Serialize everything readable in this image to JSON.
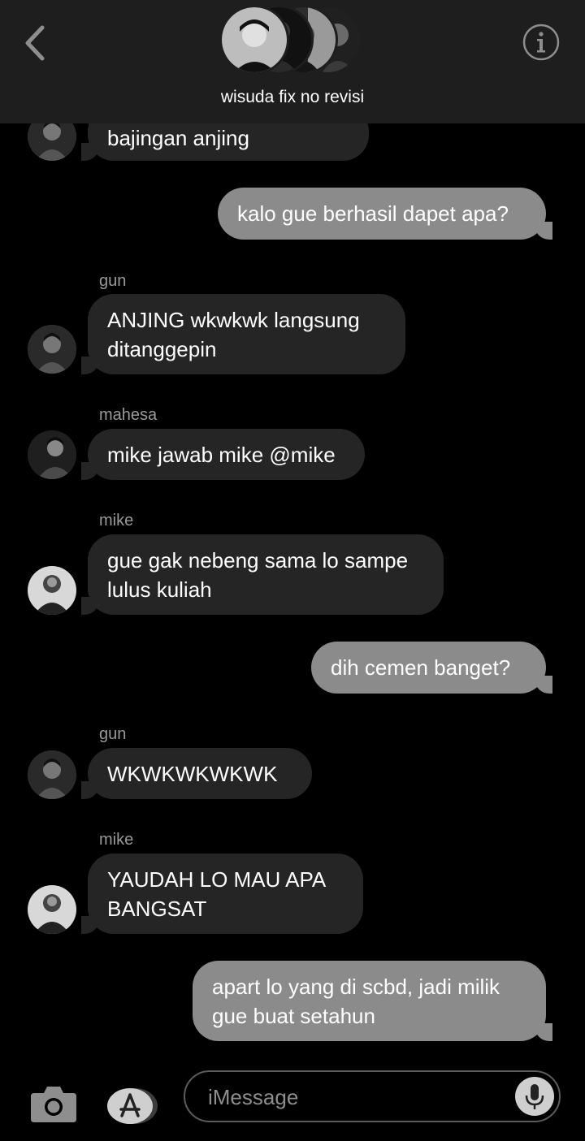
{
  "header": {
    "title": "wisuda fix no revisi",
    "back_icon": "chevron-left-icon",
    "info_icon": "info-icon"
  },
  "messages": [
    {
      "sender": "",
      "text": "bajingan anjing",
      "direction": "incoming"
    },
    {
      "sender": "",
      "text": "kalo gue berhasil dapet apa?",
      "direction": "outgoing"
    },
    {
      "sender": "gun",
      "text": "ANJING wkwkwk langsung ditanggepin",
      "direction": "incoming"
    },
    {
      "sender": "mahesa",
      "text": "mike jawab mike @mike",
      "direction": "incoming"
    },
    {
      "sender": "mike",
      "text": "gue gak nebeng sama lo sampe lulus kuliah",
      "direction": "incoming"
    },
    {
      "sender": "",
      "text": "dih cemen banget?",
      "direction": "outgoing"
    },
    {
      "sender": "gun",
      "text": "WKWKWKWKWK",
      "direction": "incoming"
    },
    {
      "sender": "mike",
      "text": "YAUDAH LO MAU APA BANGSAT",
      "direction": "incoming"
    },
    {
      "sender": "",
      "text": "apart lo yang di scbd, jadi milik gue buat setahun",
      "direction": "outgoing"
    }
  ],
  "composer": {
    "placeholder": "iMessage",
    "camera_icon": "camera-icon",
    "apps_icon": "app-store-icon",
    "mic_icon": "microphone-icon"
  },
  "colors": {
    "background": "#000000",
    "header": "#1e1e1e",
    "incoming_bubble": "#252525",
    "outgoing_bubble": "#8b8b8b",
    "sender_label": "#9a9a9a"
  }
}
